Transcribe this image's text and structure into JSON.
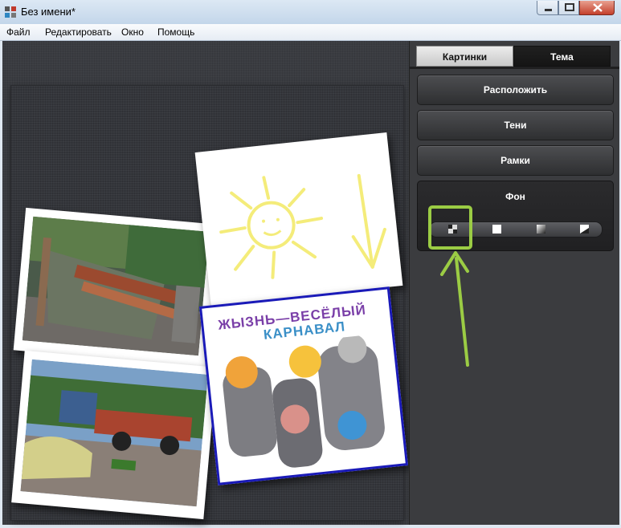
{
  "window": {
    "title": "Без имени*"
  },
  "menu": [
    "Файл",
    "Редактировать",
    "Окно",
    "Помощь"
  ],
  "tabs": {
    "pictures": "Картинки",
    "theme": "Тема"
  },
  "panel": {
    "arrange": "Расположить",
    "shadows": "Тени",
    "frames": "Рамки",
    "background": {
      "title": "Фон",
      "options": [
        "texture-icon",
        "solid-color-icon",
        "gradient-icon",
        "image-icon"
      ]
    }
  },
  "photos": {
    "carnival_caption_line1": "ЖЫЗНЬ—ВЕСЁЛЫЙ",
    "carnival_caption_line2": "КАРНАВАЛ"
  },
  "colors": {
    "highlight": "#9bcc44",
    "panel_bg": "#3b3c3f",
    "canvas_bg": "#34363b"
  }
}
